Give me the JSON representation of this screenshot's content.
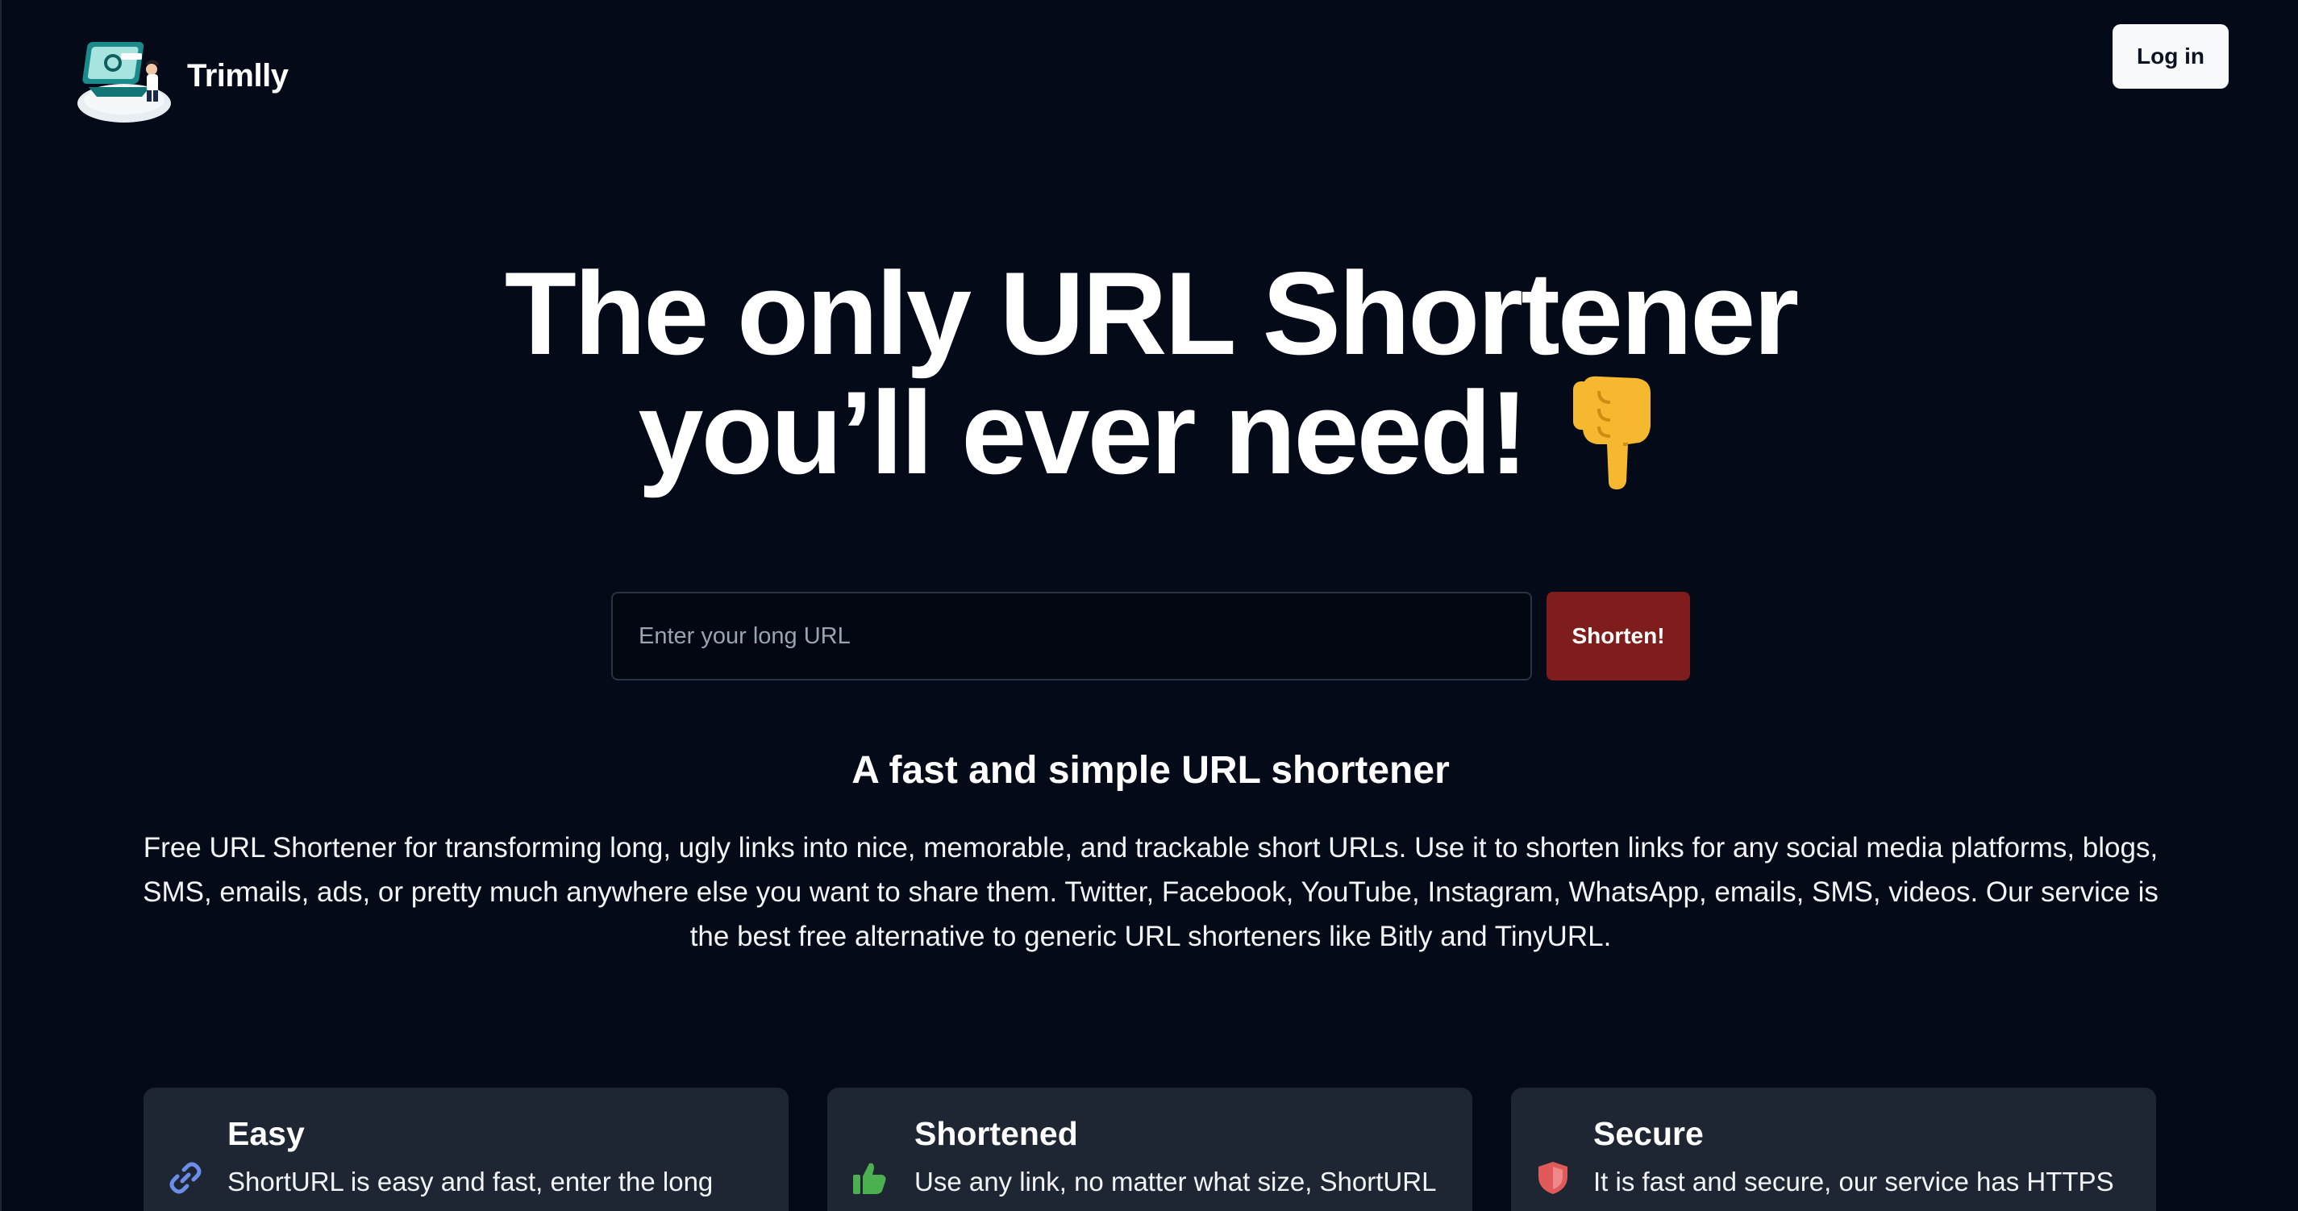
{
  "brand": {
    "name": "Trimlly",
    "logo_icon": "laptop-person-illustration-icon"
  },
  "header": {
    "login_label": "Log in"
  },
  "hero": {
    "title_line1": "The only URL Shortener",
    "title_line2": "you’ll ever need!",
    "emoji_icon": "hand-pointing-down-icon"
  },
  "form": {
    "url_placeholder": "Enter your long URL",
    "url_value": "",
    "submit_label": "Shorten!"
  },
  "description": {
    "title": "A fast and simple URL shortener",
    "body": "Free URL Shortener for transforming long, ugly links into nice, memorable, and trackable short URLs. Use it to shorten links for any social media platforms, blogs, SMS, emails, ads, or pretty much anywhere else you want to share them. Twitter, Facebook, YouTube, Instagram, WhatsApp, emails, SMS, videos. Our service is the best free alternative to generic URL shorteners like Bitly and TinyURL."
  },
  "features": [
    {
      "icon": "link-icon",
      "title": "Easy",
      "text": "ShortURL is easy and fast, enter the long link to get your shortened link"
    },
    {
      "icon": "thumbs-up-icon",
      "title": "Shortened",
      "text": "Use any link, no matter what size, ShortURL always shortens"
    },
    {
      "icon": "shield-icon",
      "title": "Secure",
      "text": "It is fast and secure, our service has HTTPS protocol and data encryption"
    }
  ],
  "colors": {
    "background": "#040a17",
    "accent_button": "#7f1d1d",
    "card_background": "#1f2633",
    "link_icon": "#6b8fe8",
    "thumbs_icon": "#4caf50",
    "shield_icon": "#e05a5a"
  }
}
